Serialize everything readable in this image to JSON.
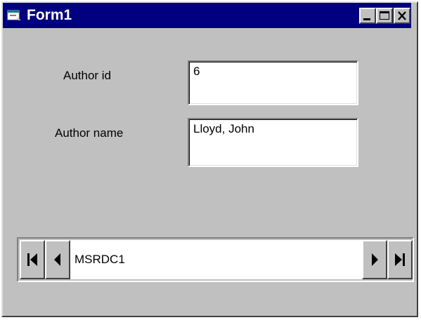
{
  "window": {
    "title": "Form1",
    "controls": [
      "minimize-icon",
      "maximize-icon",
      "close-icon"
    ]
  },
  "form": {
    "author_id_label": "Author id",
    "author_id_value": "6",
    "author_name_label": "Author name",
    "author_name_value": "Lloyd, John"
  },
  "data_control": {
    "caption": "MSRDC1",
    "buttons": [
      "move-first-icon",
      "move-previous-icon",
      "move-next-icon",
      "move-last-icon"
    ]
  },
  "colors": {
    "titlebar": "#000080",
    "face": "#c0c0c0",
    "field_bg": "#ffffff"
  }
}
